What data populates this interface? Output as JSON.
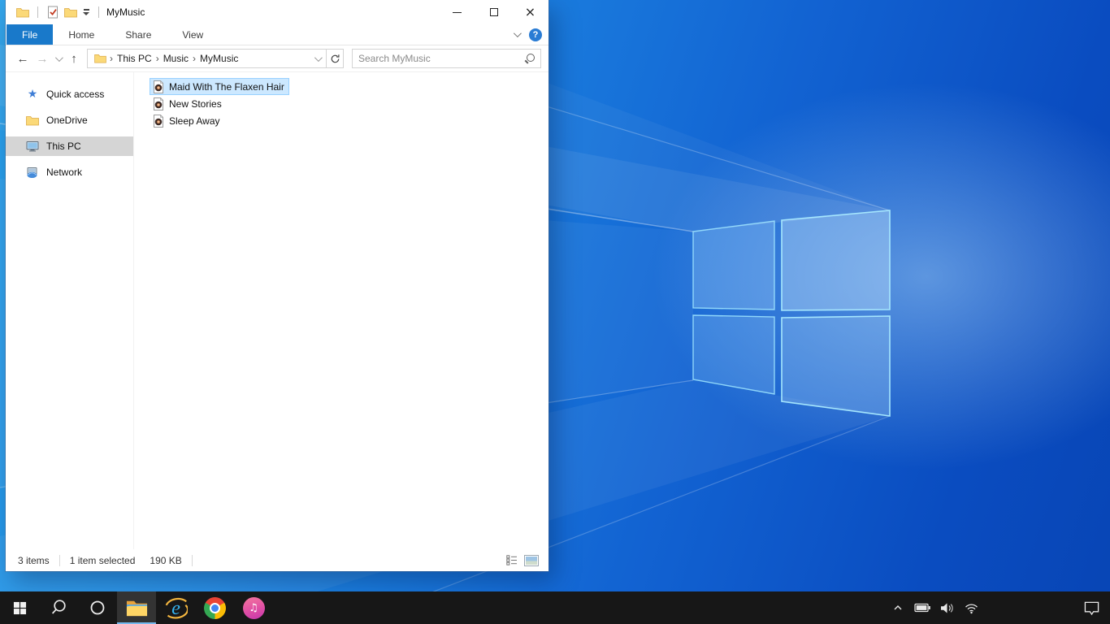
{
  "colors": {
    "accent_blue": "#1979ca",
    "selection_bg": "#cce8ff",
    "selection_border": "#99d1ff",
    "sidebar_selected_bg": "#d5d5d5",
    "folder_yellow": "#fbd978",
    "taskbar_bg": "#171717",
    "taskbar_active_underline": "#76b9ed",
    "wallpaper_light": "#2ba2ea",
    "wallpaper_dark": "#0845b5"
  },
  "window": {
    "title": "MyMusic",
    "tabs": [
      {
        "label": "File",
        "active": true
      },
      {
        "label": "Home",
        "active": false
      },
      {
        "label": "Share",
        "active": false
      },
      {
        "label": "View",
        "active": false
      }
    ],
    "nav": {
      "breadcrumb": [
        "This PC",
        "Music",
        "MyMusic"
      ],
      "search_placeholder": "Search MyMusic"
    },
    "sidebar": [
      {
        "label": "Quick access",
        "icon": "star",
        "selected": false
      },
      {
        "label": "OneDrive",
        "icon": "folder",
        "selected": false
      },
      {
        "label": "This PC",
        "icon": "monitor",
        "selected": true
      },
      {
        "label": "Network",
        "icon": "network",
        "selected": false
      }
    ],
    "files": [
      {
        "name": "Maid With The Flaxen Hair",
        "type": "audio",
        "selected": true
      },
      {
        "name": "New Stories",
        "type": "audio",
        "selected": false
      },
      {
        "name": "Sleep Away",
        "type": "audio",
        "selected": false
      }
    ],
    "status": {
      "count": "3 items",
      "selected": "1 item selected",
      "size": "190 KB"
    }
  },
  "taskbar": {
    "apps": [
      "start",
      "search",
      "cortana",
      "file-explorer",
      "internet-explorer",
      "chrome",
      "itunes"
    ],
    "active_app": "file-explorer",
    "tray": [
      "hidden-icons-chevron",
      "battery",
      "volume",
      "wifi",
      "action-center"
    ]
  },
  "glyphs": {
    "back": "←",
    "forward": "→",
    "up": "↑",
    "crumb_sep": "›",
    "star": "★",
    "check": "✓",
    "close": "×",
    "help": "?",
    "ie_e": "e",
    "music_note": "♫"
  }
}
